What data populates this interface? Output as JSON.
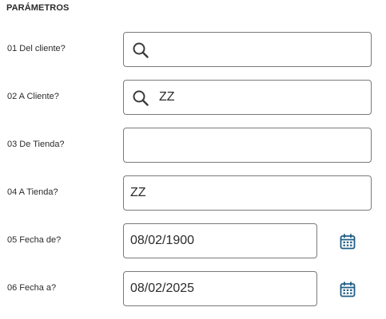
{
  "section": {
    "title": "PARÁMETROS"
  },
  "params": [
    {
      "label": "01 Del cliente?",
      "value": ""
    },
    {
      "label": "02 A Cliente?",
      "value": "ZZ"
    },
    {
      "label": "03 De Tienda?",
      "value": ""
    },
    {
      "label": "04 A Tienda?",
      "value": "ZZ"
    },
    {
      "label": "05 Fecha de?",
      "value": "08/02/1900"
    },
    {
      "label": "06 Fecha a?",
      "value": "08/02/2025"
    }
  ],
  "colors": {
    "border": "#7a7a7a",
    "icon": "#3a3a3a",
    "calendar": "#1f5e86"
  },
  "icons": {
    "search": "search-icon",
    "calendar": "calendar-icon"
  }
}
